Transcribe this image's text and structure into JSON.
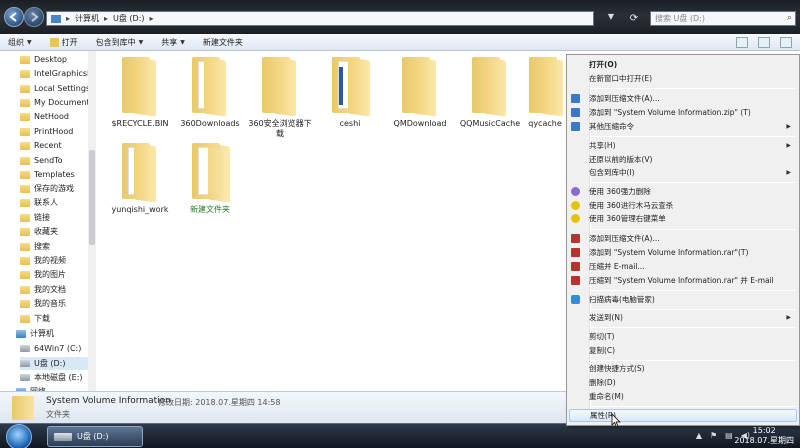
{
  "address": {
    "crumbs": [
      "计算机",
      "U盘 (D:)"
    ],
    "search_placeholder": "搜索 U盘 (D:)"
  },
  "toolbar": {
    "organize": "组织",
    "open": "打开",
    "include": "包含到库中",
    "share": "共享",
    "new_folder": "新建文件夹"
  },
  "sidebar": {
    "items": [
      "Desktop",
      "IntelGraphicsP",
      "Local Settings",
      "My Documents",
      "NetHood",
      "PrintHood",
      "Recent",
      "SendTo",
      "Templates",
      "保存的游戏",
      "联系人",
      "链接",
      "收藏夹",
      "搜索",
      "我的视频",
      "我的图片",
      "我的文档",
      "我的音乐",
      "下载",
      "计算机",
      "64Win7 (C:)",
      "U盘 (D:)",
      "本地磁盘 (E:)",
      "网络"
    ]
  },
  "files": [
    {
      "name": "$RECYCLE.BIN"
    },
    {
      "name": "360Downloads"
    },
    {
      "name": "360安全浏览器下载"
    },
    {
      "name": "ceshi"
    },
    {
      "name": "QMDownload"
    },
    {
      "name": "QQMusicCache"
    },
    {
      "name": "qycache"
    },
    {
      "name": "yunqishi_work"
    },
    {
      "name": "新建文件夹"
    }
  ],
  "details": {
    "name": "System Volume Information",
    "meta": "修改日期: 2018.07.星期四 14:58",
    "type": "文件夹"
  },
  "taskbar": {
    "task_label": "U盘 (D:)",
    "clock_time": "15:02",
    "clock_date": "2018.07.星期四"
  },
  "context_menu": {
    "items": [
      {
        "label": "打开(O)"
      },
      {
        "label": "在新窗口中打开(E)"
      },
      {
        "label": "添加到压缩文件(A)..."
      },
      {
        "label": "添加到 \"System Volume Information.zip\" (T)"
      },
      {
        "label": "其他压缩命令"
      },
      {
        "label": "共享(H)"
      },
      {
        "label": "还原以前的版本(V)"
      },
      {
        "label": "包含到库中(I)"
      },
      {
        "label": "使用 360强力删除"
      },
      {
        "label": "使用 360进行木马云查杀"
      },
      {
        "label": "使用 360管理右键菜单"
      },
      {
        "label": "添加到压缩文件(A)..."
      },
      {
        "label": "添加到 \"System Volume Information.rar\"(T)"
      },
      {
        "label": "压缩并 E-mail..."
      },
      {
        "label": "压缩到 \"System Volume Information.rar\" 并 E-mail"
      },
      {
        "label": "扫描病毒(电脑管家)"
      },
      {
        "label": "发送到(N)"
      },
      {
        "label": "剪切(T)"
      },
      {
        "label": "复制(C)"
      },
      {
        "label": "创建快捷方式(S)"
      },
      {
        "label": "删除(D)"
      },
      {
        "label": "重命名(M)"
      },
      {
        "label": "属性(R)"
      }
    ]
  }
}
